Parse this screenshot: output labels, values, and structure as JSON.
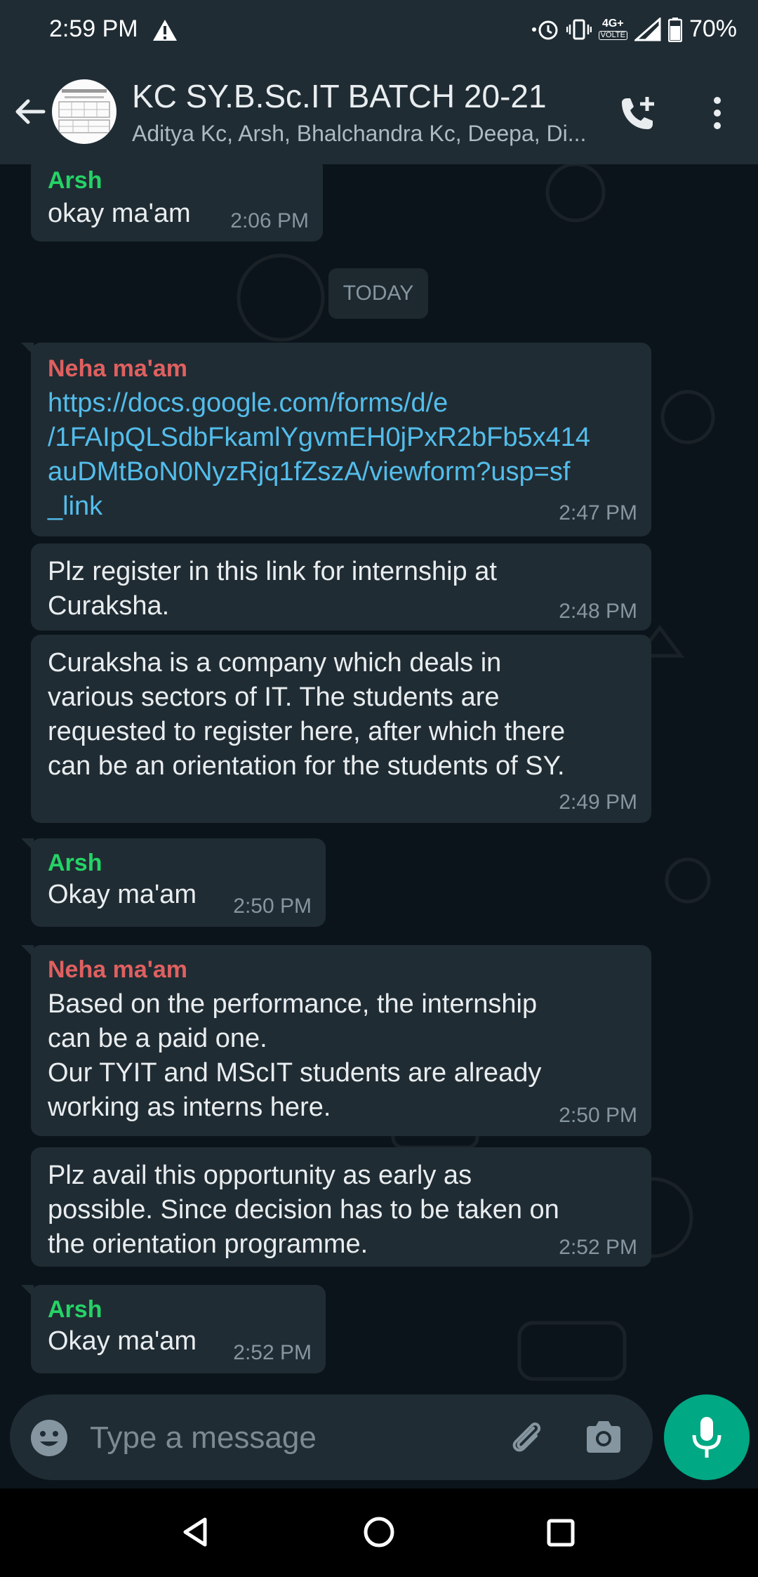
{
  "status_bar": {
    "time": "2:59 PM",
    "network": "4G+",
    "network_sub": "VOLTE",
    "battery": "70%"
  },
  "header": {
    "title": "KC SY.B.Sc.IT BATCH 20-21",
    "subtitle": "Aditya Kc, Arsh, Bhalchandra Kc, Deepa, Di..."
  },
  "chat": {
    "date_divider": "TODAY",
    "messages": [
      {
        "sender": "Arsh",
        "text": "okay ma'am",
        "time": "2:06 PM"
      },
      {
        "sender": "Neha ma'am",
        "text": "https://docs.google.com/forms/d/e\n/1FAIpQLSdbFkamlYgvmEH0jPxR2bFb5x414\nauDMtBoN0NyzRjq1fZszA/viewform?usp=sf\n_link",
        "time": "2:47 PM"
      },
      {
        "sender": "",
        "text": "Plz register in this link for internship at\nCuraksha.",
        "time": "2:48 PM"
      },
      {
        "sender": "",
        "text": "Curaksha is a company which deals in\nvarious sectors of IT. The students are\nrequested to register here, after which there\ncan be an orientation for the students of SY.",
        "time": "2:49 PM"
      },
      {
        "sender": "Arsh",
        "text": "Okay ma'am",
        "time": "2:50 PM"
      },
      {
        "sender": "Neha ma'am",
        "text": "Based on the performance, the internship\ncan be a paid one.\nOur TYIT and MScIT students are already\nworking as interns here.",
        "time": "2:50 PM"
      },
      {
        "sender": "",
        "text": "Plz avail this opportunity as early as\npossible. Since decision has to be taken on\nthe orientation programme.",
        "time": "2:52 PM"
      },
      {
        "sender": "Arsh",
        "text": "Okay ma'am",
        "time": "2:52 PM"
      }
    ]
  },
  "composer": {
    "placeholder": "Type a message"
  },
  "icons": {
    "back": "arrow-left-icon",
    "call": "add-call-icon",
    "menu": "more-vert-icon",
    "emoji": "emoji-icon",
    "attach": "paperclip-icon",
    "camera": "camera-icon",
    "mic": "mic-icon"
  },
  "colors": {
    "accent": "#00a884",
    "sender_arsh": "#25d366",
    "sender_neha": "#e06060",
    "link": "#53bdeb",
    "bubble": "#202c33"
  }
}
